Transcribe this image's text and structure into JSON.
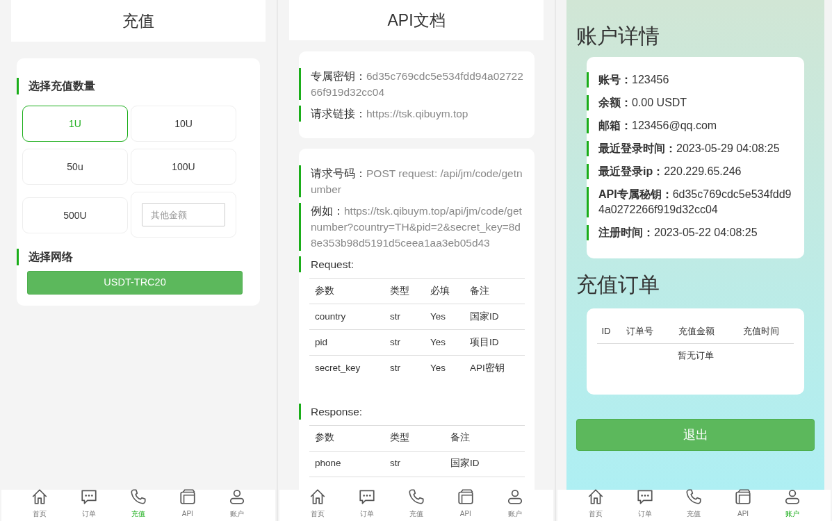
{
  "recharge": {
    "title": "充值",
    "amount_heading": "选择充值数量",
    "amounts": [
      {
        "kind": "option",
        "label": "1U",
        "selected": true
      },
      {
        "kind": "option",
        "label": "10U",
        "selected": false
      },
      {
        "kind": "option",
        "label": "50u",
        "selected": false
      },
      {
        "kind": "option",
        "label": "100U",
        "selected": false
      },
      {
        "kind": "option",
        "label": "500U",
        "selected": false
      },
      {
        "kind": "input",
        "placeholder": "其他金额"
      }
    ],
    "network_heading": "选择网络",
    "network_button": "USDT-TRC20"
  },
  "api_docs": {
    "title": "API文档",
    "info": [
      {
        "label": "专属密钥：",
        "value": "6d35c769cdc5e534fdd94a0272266f919d32cc04"
      },
      {
        "label": "请求链接：",
        "value": "https://tsk.qibuym.top"
      }
    ],
    "endpoint": [
      {
        "label": "请求号码：",
        "value": "POST request: /api/jm/code/getnumber"
      },
      {
        "label": "例如：",
        "value": "https://tsk.qibuym.top/api/jm/code/getnumber?country=TH&pid=2&secret_key=8d8e353b98d5191d5ceea1aa3eb05d43"
      }
    ],
    "request": {
      "heading": "Request:",
      "columns": [
        "参数",
        "类型",
        "必填",
        "备注"
      ],
      "rows": [
        [
          "country",
          "str",
          "Yes",
          "国家ID"
        ],
        [
          "pid",
          "str",
          "Yes",
          "项目ID"
        ],
        [
          "secret_key",
          "str",
          "Yes",
          "API密钥"
        ]
      ]
    },
    "response": {
      "heading": "Response:",
      "columns": [
        "参数",
        "类型",
        "备注"
      ],
      "rows": [
        [
          "phone",
          "str",
          "国家ID"
        ]
      ]
    }
  },
  "account": {
    "title": "账户详情",
    "fields": [
      {
        "label": "账号：",
        "value": "123456"
      },
      {
        "label": "余额：",
        "value": "0.00 USDT"
      },
      {
        "label": "邮箱：",
        "value": "123456@qq.com"
      },
      {
        "label": "最近登录时间：",
        "value": "2023-05-29 04:08:25"
      },
      {
        "label": "最近登录ip：",
        "value": "220.229.65.246"
      },
      {
        "label": "API专属秘钥：",
        "value": "6d35c769cdc5e534fdd94a0272266f919d32cc04"
      },
      {
        "label": "注册时间：",
        "value": "2023-05-22 04:08:25"
      }
    ],
    "orders_title": "充值订单",
    "orders_columns": [
      "ID",
      "订单号",
      "充值金额",
      "充值时间"
    ],
    "orders_empty": "暂无订单",
    "logout_button": "退出"
  },
  "tab_bars": [
    {
      "tabs": [
        {
          "label": "首页",
          "selected": false
        },
        {
          "label": "订单",
          "selected": false
        },
        {
          "label": "充值",
          "selected": true
        },
        {
          "label": "API",
          "selected": false
        },
        {
          "label": "账户",
          "selected": false
        }
      ]
    },
    {
      "tabs": [
        {
          "label": "首页",
          "selected": false
        },
        {
          "label": "订单",
          "selected": false
        },
        {
          "label": "充值",
          "selected": false
        },
        {
          "label": "API",
          "selected": false
        },
        {
          "label": "账户",
          "selected": false
        }
      ]
    },
    {
      "tabs": [
        {
          "label": "首页",
          "selected": false
        },
        {
          "label": "订单",
          "selected": false
        },
        {
          "label": "充值",
          "selected": false
        },
        {
          "label": "API",
          "selected": false
        },
        {
          "label": "账户",
          "selected": true
        }
      ]
    }
  ]
}
